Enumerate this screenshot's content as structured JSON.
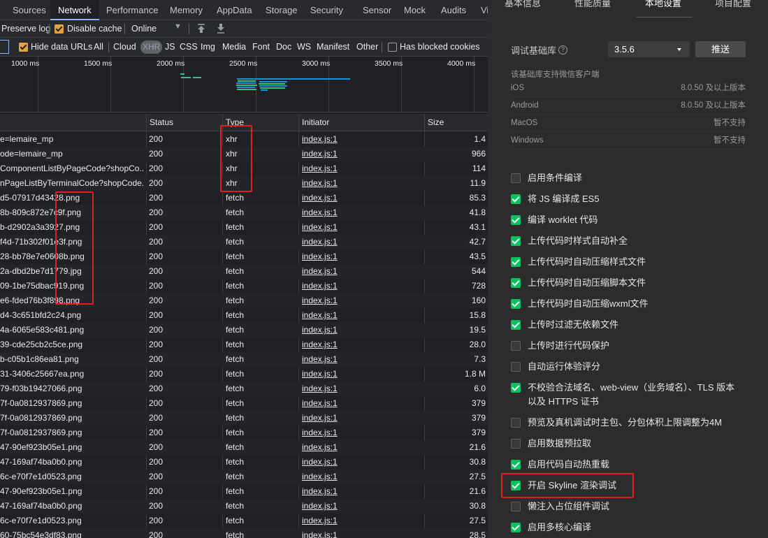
{
  "devtools": {
    "tabs": [
      "Sources",
      "Network",
      "Performance",
      "Memory",
      "AppData",
      "Storage",
      "Security",
      "Sensor",
      "Mock",
      "Audits",
      "Vi"
    ],
    "active_tab": "Network",
    "toolbar": {
      "preserve_log": "Preserve log",
      "disable_cache": "Disable cache",
      "throttle": "Online"
    },
    "filter": {
      "hide_data_urls": "Hide data URLs",
      "types": [
        "All",
        "Cloud",
        "XHR",
        "JS",
        "CSS",
        "Img",
        "Media",
        "Font",
        "Doc",
        "WS",
        "Manifest",
        "Other"
      ],
      "blocked_cookies": "Has blocked cookies"
    },
    "overview_ticks": [
      "1000 ms",
      "1500 ms",
      "2000 ms",
      "2500 ms",
      "3000 ms",
      "3500 ms",
      "4000 ms"
    ],
    "columns": {
      "status": "Status",
      "type": "Type",
      "initiator": "Initiator",
      "size": "Size"
    },
    "requests": [
      {
        "name": "e=lemaire_mp",
        "status": "200",
        "type": "xhr",
        "initiator": "index.js:1",
        "size": "1.4"
      },
      {
        "name": "ode=lemaire_mp",
        "status": "200",
        "type": "xhr",
        "initiator": "index.js:1",
        "size": "966"
      },
      {
        "name": "ComponentListByPageCode?shopCo...",
        "status": "200",
        "type": "xhr",
        "initiator": "index.js:1",
        "size": "114"
      },
      {
        "name": "nPageListByTerminalCode?shopCode...",
        "status": "200",
        "type": "xhr",
        "initiator": "index.js:1",
        "size": "11.9"
      },
      {
        "name": "d5-07917d43428.png",
        "status": "200",
        "type": "fetch",
        "initiator": "index.js:1",
        "size": "85.3"
      },
      {
        "name": "8b-809c872e7c9f.png",
        "status": "200",
        "type": "fetch",
        "initiator": "index.js:1",
        "size": "41.8"
      },
      {
        "name": "b-d2902a3a3927.png",
        "status": "200",
        "type": "fetch",
        "initiator": "index.js:1",
        "size": "43.1"
      },
      {
        "name": "f4d-71b302f01e3f.png",
        "status": "200",
        "type": "fetch",
        "initiator": "index.js:1",
        "size": "42.7"
      },
      {
        "name": "28-bb78e7e0608b.png",
        "status": "200",
        "type": "fetch",
        "initiator": "index.js:1",
        "size": "43.5"
      },
      {
        "name": "2a-dbd2be7d1779.jpg",
        "status": "200",
        "type": "fetch",
        "initiator": "index.js:1",
        "size": "544"
      },
      {
        "name": "09-1be75dbac919.png",
        "status": "200",
        "type": "fetch",
        "initiator": "index.js:1",
        "size": "728"
      },
      {
        "name": "e6-fded76b3f898.png",
        "status": "200",
        "type": "fetch",
        "initiator": "index.js:1",
        "size": "160"
      },
      {
        "name": "d4-3c651bfd2c24.png",
        "status": "200",
        "type": "fetch",
        "initiator": "index.js:1",
        "size": "15.8"
      },
      {
        "name": "4a-6065e583c481.png",
        "status": "200",
        "type": "fetch",
        "initiator": "index.js:1",
        "size": "19.5"
      },
      {
        "name": "39-cde25cb2c5ce.png",
        "status": "200",
        "type": "fetch",
        "initiator": "index.js:1",
        "size": "28.0"
      },
      {
        "name": "b-c05b1c86ea81.png",
        "status": "200",
        "type": "fetch",
        "initiator": "index.js:1",
        "size": "7.3"
      },
      {
        "name": "31-3406c25667ea.png",
        "status": "200",
        "type": "fetch",
        "initiator": "index.js:1",
        "size": "1.8 M"
      },
      {
        "name": "79-f03b19427066.png",
        "status": "200",
        "type": "fetch",
        "initiator": "index.js:1",
        "size": "6.0"
      },
      {
        "name": "7f-0a0812937869.png",
        "status": "200",
        "type": "fetch",
        "initiator": "index.js:1",
        "size": "379"
      },
      {
        "name": "7f-0a0812937869.png",
        "status": "200",
        "type": "fetch",
        "initiator": "index.js:1",
        "size": "379"
      },
      {
        "name": "7f-0a0812937869.png",
        "status": "200",
        "type": "fetch",
        "initiator": "index.js:1",
        "size": "379"
      },
      {
        "name": "47-90ef923b05e1.png",
        "status": "200",
        "type": "fetch",
        "initiator": "index.js:1",
        "size": "21.6"
      },
      {
        "name": "47-169af74ba0b0.png",
        "status": "200",
        "type": "fetch",
        "initiator": "index.js:1",
        "size": "30.8"
      },
      {
        "name": "6c-e70f7e1d0523.png",
        "status": "200",
        "type": "fetch",
        "initiator": "index.js:1",
        "size": "27.5"
      },
      {
        "name": "47-90ef923b05e1.png",
        "status": "200",
        "type": "fetch",
        "initiator": "index.js:1",
        "size": "21.6"
      },
      {
        "name": "47-169af74ba0b0.png",
        "status": "200",
        "type": "fetch",
        "initiator": "index.js:1",
        "size": "30.8"
      },
      {
        "name": "6c-e70f7e1d0523.png",
        "status": "200",
        "type": "fetch",
        "initiator": "index.js:1",
        "size": "27.5"
      },
      {
        "name": "60-75bc54e3df83.png",
        "status": "200",
        "type": "fetch",
        "initiator": "index.js:1",
        "size": "28.5"
      }
    ]
  },
  "settings": {
    "tabs": [
      "基本信息",
      "性能质量",
      "本地设置",
      "项目配置"
    ],
    "active_tab": "本地设置",
    "base_lib_label": "调试基础库",
    "base_lib_version": "3.5.6",
    "push_button": "推送",
    "support_title": "该基础库支持微信客户端",
    "platforms": [
      {
        "name": "iOS",
        "value": "8.0.50 及以上版本"
      },
      {
        "name": "Android",
        "value": "8.0.50 及以上版本"
      },
      {
        "name": "MacOS",
        "value": "暂不支持"
      },
      {
        "name": "Windows",
        "value": "暂不支持"
      }
    ],
    "options": [
      {
        "label": "启用条件编译",
        "checked": false
      },
      {
        "label": "将 JS 编译成 ES5",
        "checked": true
      },
      {
        "label": "编译 worklet 代码",
        "checked": true
      },
      {
        "label": "上传代码时样式自动补全",
        "checked": true
      },
      {
        "label": "上传代码时自动压缩样式文件",
        "checked": true
      },
      {
        "label": "上传代码时自动压缩脚本文件",
        "checked": true
      },
      {
        "label": "上传代码时自动压缩wxml文件",
        "checked": true
      },
      {
        "label": "上传时过滤无依赖文件",
        "checked": true
      },
      {
        "label": "上传时进行代码保护",
        "checked": false
      },
      {
        "label": "自动运行体验评分",
        "checked": false
      },
      {
        "label": "不校验合法域名、web-view（业务域名）、TLS 版本以及 HTTPS 证书",
        "checked": true
      },
      {
        "label": "预览及真机调试时主包、分包体积上限调整为4M",
        "checked": false
      },
      {
        "label": "启用数据预拉取",
        "checked": false
      },
      {
        "label": "启用代码自动热重载",
        "checked": true
      },
      {
        "label": "开启 Skyline 渲染调试",
        "checked": true
      },
      {
        "label": "懒注入占位组件调试",
        "checked": false
      },
      {
        "label": "启用多核心编译",
        "checked": true
      }
    ]
  },
  "colors": {
    "accent_blue": "#8ab4f8",
    "checkbox_orange": "#e8a33d",
    "checkbox_green": "#07c160",
    "highlight_red": "#e02020"
  }
}
